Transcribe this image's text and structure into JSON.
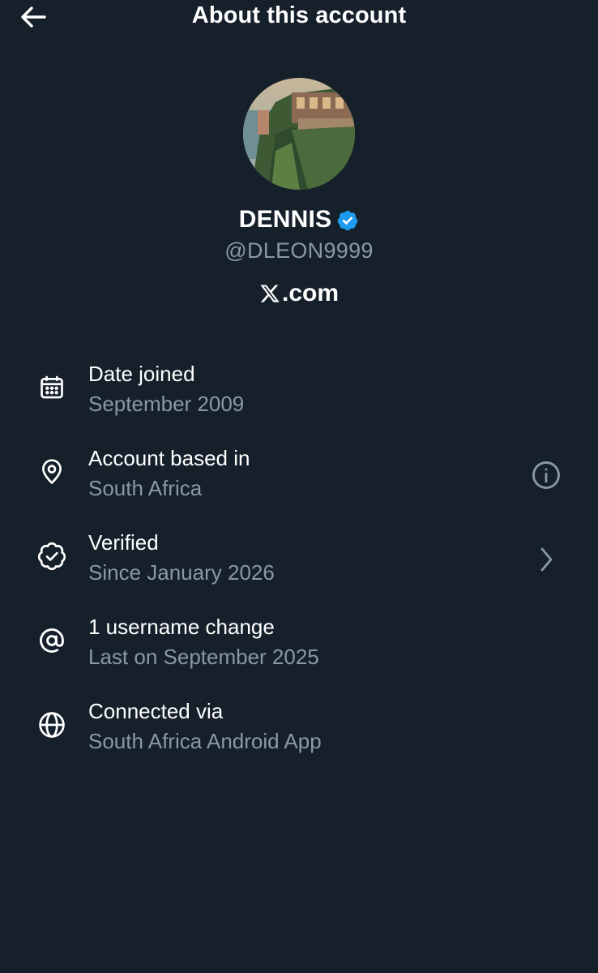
{
  "header": {
    "back_icon": "arrow-left-icon",
    "title": "About this account"
  },
  "profile": {
    "avatar": "profile-photo",
    "display_name": "DENNIS",
    "verified_badge_icon": "verified-badge-icon",
    "verified_badge_color": "#1d9bf0",
    "handle": "@DLEON9999",
    "site_logo_icon": "x-logo-icon",
    "site_text": ".com"
  },
  "items": [
    {
      "icon": "calendar-icon",
      "title": "Date joined",
      "subtitle": "September 2009"
    },
    {
      "icon": "location-pin-icon",
      "title": "Account based in",
      "subtitle": "South Africa",
      "action_icon": "info-circle-icon"
    },
    {
      "icon": "verified-check-icon",
      "title": "Verified",
      "subtitle": "Since January 2026",
      "action_icon": "chevron-right-icon"
    },
    {
      "icon": "at-sign-icon",
      "title": "1 username change",
      "subtitle": "Last on September 2025"
    },
    {
      "icon": "globe-icon",
      "title": "Connected via",
      "subtitle": "South Africa Android App"
    }
  ],
  "colors": {
    "background": "#15202b",
    "primary_text": "#ffffff",
    "secondary_text": "#8b98a5",
    "accent": "#1d9bf0"
  }
}
